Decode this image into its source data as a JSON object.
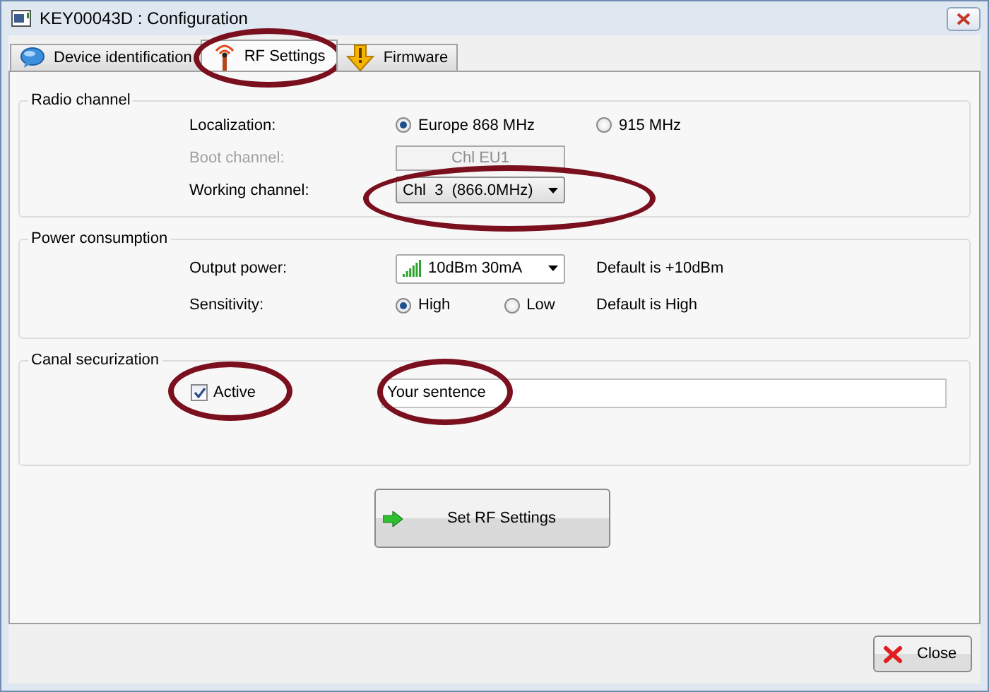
{
  "window": {
    "title": "KEY00043D : Configuration"
  },
  "tabs": [
    {
      "label": "Device identification",
      "selected": false,
      "circled": false
    },
    {
      "label": "RF Settings",
      "selected": true,
      "circled": true
    },
    {
      "label": "Firmware",
      "selected": false,
      "circled": false
    }
  ],
  "radio_channel": {
    "title": "Radio channel",
    "localization": {
      "label": "Localization:",
      "options": [
        {
          "label": "Europe 868 MHz",
          "selected": true
        },
        {
          "label": "915 MHz",
          "selected": false
        }
      ]
    },
    "boot_channel": {
      "label": "Boot channel:",
      "value": "Chl EU1",
      "disabled": true
    },
    "working_channel": {
      "label": "Working channel:",
      "value": "Chl  3  (866.0MHz)",
      "circled": true
    }
  },
  "power_consumption": {
    "title": "Power consumption",
    "output_power": {
      "label": "Output power:",
      "value": "10dBm 30mA",
      "note": "Default is +10dBm"
    },
    "sensitivity": {
      "label": "Sensitivity:",
      "options": [
        {
          "label": "High",
          "selected": true
        },
        {
          "label": "Low",
          "selected": false
        }
      ],
      "note": "Default is High"
    }
  },
  "canal_securization": {
    "title": "Canal securization",
    "active": {
      "label": "Active",
      "checked": true,
      "circled": true
    },
    "sentence": {
      "value": "Your sentence",
      "circled": true
    }
  },
  "set_button": {
    "label": "Set RF Settings"
  },
  "close_button": {
    "label": "Close"
  }
}
